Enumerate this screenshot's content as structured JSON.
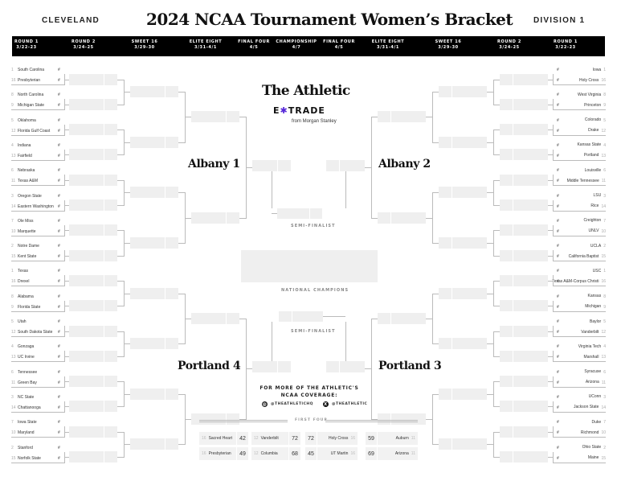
{
  "header": {
    "left_label": "CLEVELAND",
    "title": "2024 NCAA Tournament Women’s Bracket",
    "right_label": "DIVISION 1"
  },
  "rounds": [
    {
      "name": "ROUND 1",
      "dates": "3/22-23"
    },
    {
      "name": "ROUND 2",
      "dates": "3/24-25"
    },
    {
      "name": "SWEET 16",
      "dates": "3/29-30"
    },
    {
      "name": "ELITE EIGHT",
      "dates": "3/31-4/1"
    },
    {
      "name": "FINAL FOUR",
      "dates": "4/5"
    },
    {
      "name": "CHAMPIONSHIP",
      "dates": "4/7"
    },
    {
      "name": "FINAL FOUR",
      "dates": "4/5"
    },
    {
      "name": "ELITE EIGHT",
      "dates": "3/31-4/1"
    },
    {
      "name": "SWEET 16",
      "dates": "3/29-30"
    },
    {
      "name": "ROUND 2",
      "dates": "3/24-25"
    },
    {
      "name": "ROUND 1",
      "dates": "3/22-23"
    }
  ],
  "score_placeholder": "#",
  "regions": {
    "top_left": "Albany 1",
    "top_right": "Albany 2",
    "bottom_left": "Portland 4",
    "bottom_right": "Portland 3"
  },
  "left_teams": [
    {
      "seed": "1",
      "name": "South Carolina"
    },
    {
      "seed": "16",
      "name": "Presbyterian"
    },
    {
      "seed": "8",
      "name": "North Carolina"
    },
    {
      "seed": "9",
      "name": "Michigan State"
    },
    {
      "seed": "5",
      "name": "Oklahoma"
    },
    {
      "seed": "12",
      "name": "Florida Gulf Coast"
    },
    {
      "seed": "4",
      "name": "Indiana"
    },
    {
      "seed": "13",
      "name": "Fairfield"
    },
    {
      "seed": "6",
      "name": "Nebraska"
    },
    {
      "seed": "11",
      "name": "Texas A&M"
    },
    {
      "seed": "3",
      "name": "Oregon State"
    },
    {
      "seed": "14",
      "name": "Eastern Washington"
    },
    {
      "seed": "7",
      "name": "Ole Miss"
    },
    {
      "seed": "10",
      "name": "Marquette"
    },
    {
      "seed": "2",
      "name": "Notre Dame"
    },
    {
      "seed": "15",
      "name": "Kent State"
    },
    {
      "seed": "1",
      "name": "Texas"
    },
    {
      "seed": "16",
      "name": "Drexel"
    },
    {
      "seed": "8",
      "name": "Alabama"
    },
    {
      "seed": "9",
      "name": "Florida State"
    },
    {
      "seed": "5",
      "name": "Utah"
    },
    {
      "seed": "12",
      "name": "South Dakota State"
    },
    {
      "seed": "4",
      "name": "Gonzaga"
    },
    {
      "seed": "13",
      "name": "UC Irvine"
    },
    {
      "seed": "6",
      "name": "Tennessee"
    },
    {
      "seed": "11",
      "name": "Green Bay"
    },
    {
      "seed": "3",
      "name": "NC State"
    },
    {
      "seed": "14",
      "name": "Chattanooga"
    },
    {
      "seed": "7",
      "name": "Iowa State"
    },
    {
      "seed": "10",
      "name": "Maryland"
    },
    {
      "seed": "2",
      "name": "Stanford"
    },
    {
      "seed": "15",
      "name": "Norfolk State"
    }
  ],
  "right_teams": [
    {
      "seed": "1",
      "name": "Iowa"
    },
    {
      "seed": "16",
      "name": "Holy Cross"
    },
    {
      "seed": "8",
      "name": "West Virginia"
    },
    {
      "seed": "9",
      "name": "Princeton"
    },
    {
      "seed": "5",
      "name": "Colorado"
    },
    {
      "seed": "12",
      "name": "Drake"
    },
    {
      "seed": "4",
      "name": "Kansas State"
    },
    {
      "seed": "13",
      "name": "Portland"
    },
    {
      "seed": "6",
      "name": "Louisville"
    },
    {
      "seed": "11",
      "name": "Middle Tennessee"
    },
    {
      "seed": "3",
      "name": "LSU"
    },
    {
      "seed": "14",
      "name": "Rice"
    },
    {
      "seed": "7",
      "name": "Creighton"
    },
    {
      "seed": "10",
      "name": "UNLV"
    },
    {
      "seed": "2",
      "name": "UCLA"
    },
    {
      "seed": "15",
      "name": "California Baptist"
    },
    {
      "seed": "1",
      "name": "USC"
    },
    {
      "seed": "16",
      "name": "Texas A&M-Corpus Christi"
    },
    {
      "seed": "8",
      "name": "Kansas"
    },
    {
      "seed": "9",
      "name": "Michigan"
    },
    {
      "seed": "5",
      "name": "Baylor"
    },
    {
      "seed": "12",
      "name": "Vanderbilt"
    },
    {
      "seed": "4",
      "name": "Virginia Tech"
    },
    {
      "seed": "13",
      "name": "Marshall"
    },
    {
      "seed": "6",
      "name": "Syracuse"
    },
    {
      "seed": "11",
      "name": "Arizona"
    },
    {
      "seed": "3",
      "name": "UConn"
    },
    {
      "seed": "14",
      "name": "Jackson State"
    },
    {
      "seed": "7",
      "name": "Duke"
    },
    {
      "seed": "10",
      "name": "Richmond"
    },
    {
      "seed": "2",
      "name": "Ohio State"
    },
    {
      "seed": "15",
      "name": "Maine"
    }
  ],
  "sponsor": {
    "brand": "The Athletic",
    "partner": "E*TRADE",
    "partner_sub": "from Morgan Stanley",
    "partner_accent": "#5627d8"
  },
  "center": {
    "semifinalist_label": "SEMI-FINALIST",
    "champions_label": "NATIONAL CHAMPIONS"
  },
  "promo": {
    "line1": "FOR MORE OF THE ATHLETIC'S",
    "line2": "NCAA COVERAGE:",
    "handle_threads": "@THEATHLETICHQ",
    "handle_x": "@THEATHLETIC"
  },
  "first_four": {
    "label": "FIRST FOUR",
    "games": [
      {
        "a": {
          "seed": "16",
          "name": "Sacred Heart",
          "score": "42"
        },
        "b": {
          "seed": "16",
          "name": "Presbyterian",
          "score": "49"
        }
      },
      {
        "a": {
          "seed": "12",
          "name": "Vanderbilt",
          "score": "72"
        },
        "b": {
          "seed": "12",
          "name": "Columbia",
          "score": "68"
        }
      },
      {
        "a": {
          "seed": "16",
          "name": "Holy Cross",
          "score": "72"
        },
        "b": {
          "seed": "16",
          "name": "UT Martin",
          "score": "45"
        }
      },
      {
        "a": {
          "seed": "11",
          "name": "Auburn",
          "score": "59"
        },
        "b": {
          "seed": "11",
          "name": "Arizona",
          "score": "69"
        }
      }
    ]
  }
}
